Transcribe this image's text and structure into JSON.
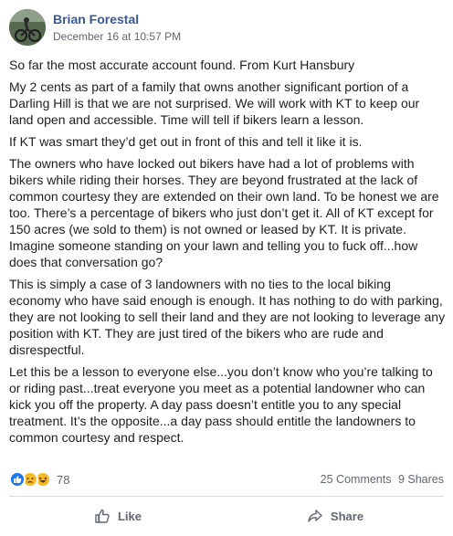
{
  "post": {
    "author": "Brian Forestal",
    "timestamp": "December 16 at 10:57 PM",
    "paragraphs": [
      "So far the most accurate account found. From Kurt Hansbury",
      "My 2 cents as part of a family that owns another significant portion of a Darling Hill is that we are not surprised. We will work with KT to keep our land open and accessible. Time will tell if bikers learn a lesson.",
      "If KT was smart they’d get out in front of this and tell it like it is.",
      "The owners who have locked out bikers have had a lot of problems with bikers while riding their horses. They are beyond frustrated at the lack of common courtesy they are extended on their own land. To be honest we are too. There’s a percentage of bikers who just don’t get it. All of KT except for 150 acres (we sold to them) is not owned or leased by KT. It is private. Imagine someone standing on your lawn and telling you to fuck off...how does that conversation go?",
      "This is simply a case of 3 landowners with no ties to the local biking economy who have said enough is enough. It has nothing to do with parking, they are not looking to sell their land and they are not looking to leverage any position with KT. They are just tired of the bikers who are rude and disrespectful.",
      "Let this be a lesson to everyone else...you don’t know who you’re talking to or riding past...treat everyone you meet as a potential landowner who can kick you off the property. A day pass doesn’t entitle you to any special treatment. It’s the opposite...a day pass should entitle the landowners to common courtesy and respect."
    ],
    "reactions": {
      "icons": [
        "like-icon",
        "sad-icon",
        "haha-icon"
      ],
      "count": "78"
    },
    "comments_label": "25 Comments",
    "shares_label": "9 Shares",
    "actions": {
      "like_label": "Like",
      "share_label": "Share"
    },
    "colors": {
      "author": "#385898",
      "like": "#1877f2",
      "reaction_yellow": "#f7b928"
    }
  }
}
